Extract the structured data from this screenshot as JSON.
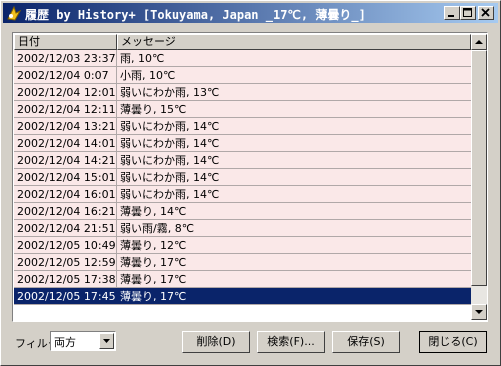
{
  "window": {
    "title": "履歴 by History+ [Tokuyama, Japan _17℃, 薄曇り_]",
    "accent": "#0a246a",
    "row_background": "#fae8e8"
  },
  "list": {
    "columns": [
      "日付",
      "メッセージ"
    ],
    "rows": [
      {
        "date": "2002/12/03 23:37",
        "message": "雨, 10℃"
      },
      {
        "date": "2002/12/04 0:07",
        "message": "小雨, 10℃"
      },
      {
        "date": "2002/12/04 12:01",
        "message": "弱いにわか雨, 13℃"
      },
      {
        "date": "2002/12/04 12:11",
        "message": "薄曇り, 15℃"
      },
      {
        "date": "2002/12/04 13:21",
        "message": "弱いにわか雨, 14℃"
      },
      {
        "date": "2002/12/04 14:01",
        "message": "弱いにわか雨, 14℃"
      },
      {
        "date": "2002/12/04 14:21",
        "message": "弱いにわか雨, 14℃"
      },
      {
        "date": "2002/12/04 15:01",
        "message": "弱いにわか雨, 14℃"
      },
      {
        "date": "2002/12/04 16:01",
        "message": "弱いにわか雨, 14℃"
      },
      {
        "date": "2002/12/04 16:21",
        "message": "薄曇り, 14℃"
      },
      {
        "date": "2002/12/04 21:51",
        "message": "弱い雨/霧, 8℃"
      },
      {
        "date": "2002/12/05 10:49",
        "message": "薄曇り, 12℃"
      },
      {
        "date": "2002/12/05 12:59",
        "message": "薄曇り, 17℃"
      },
      {
        "date": "2002/12/05 17:38",
        "message": "薄曇り, 17℃"
      },
      {
        "date": "2002/12/05 17:45",
        "message": "薄曇り, 17℃",
        "selected": true
      }
    ]
  },
  "footer": {
    "filter_label": "フィルタ",
    "filter_value": "両方",
    "buttons": {
      "delete": "削除(D)",
      "search": "検索(F)...",
      "save": "保存(S)",
      "close": "閉じる(C)"
    }
  }
}
